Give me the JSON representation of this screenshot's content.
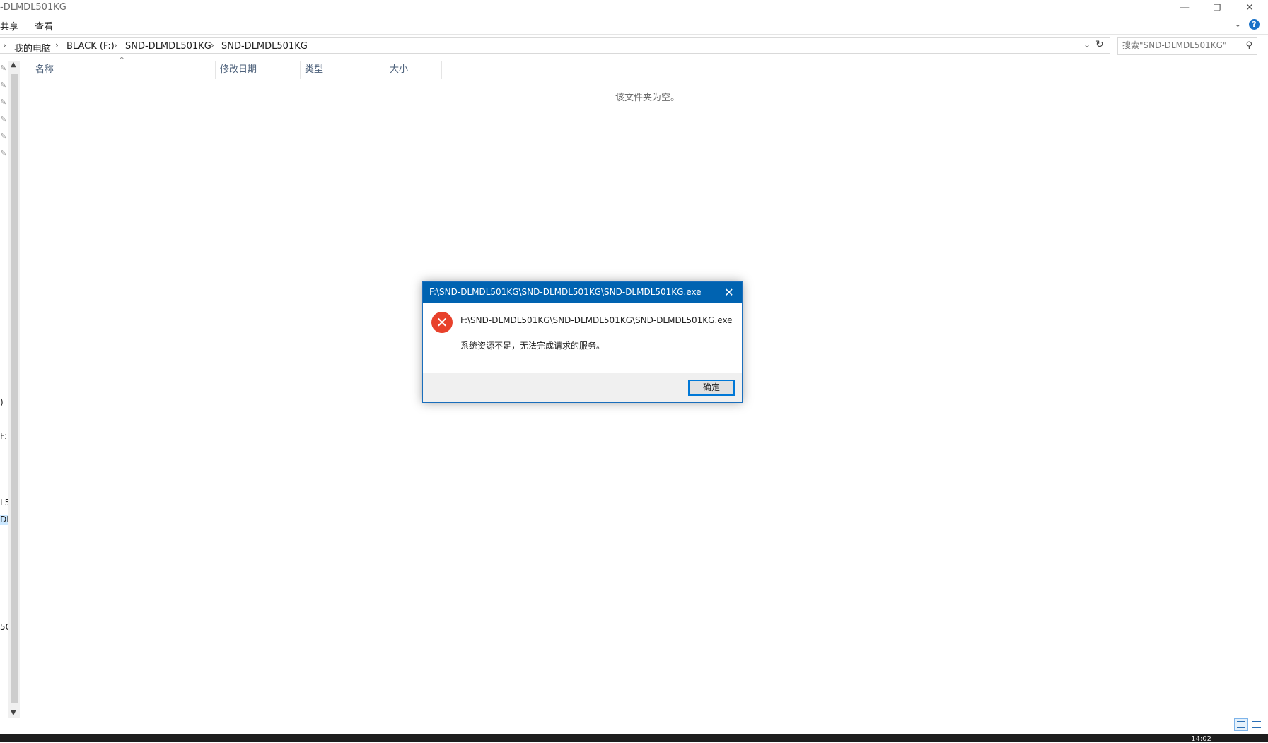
{
  "window": {
    "title": "-DLMDL501KG",
    "controls": {
      "minimize": "—",
      "restore": "❐",
      "close": "✕"
    }
  },
  "ribbon": {
    "tabs": [
      "共享",
      "查看"
    ],
    "visible_tabs_text": {
      "share": "共享",
      "view": "查看"
    },
    "help": "?"
  },
  "address": {
    "breadcrumbs": [
      "我的电脑",
      "BLACK (F:)",
      "SND-DLMDL501KG",
      "SND-DLMDL501KG"
    ],
    "crumb_0": "我的电脑",
    "crumb_1": "BLACK (F:)",
    "crumb_2": "SND-DLMDL501KG",
    "crumb_3": "SND-DLMDL501KG"
  },
  "search": {
    "placeholder": "搜索\"SND-DLMDL501KG\""
  },
  "nav_fragments": {
    "f1": ")",
    "f2": "F:)",
    "f3": "L5",
    "f4": "DI",
    "f5": "50"
  },
  "columns": {
    "name": "名称",
    "modified": "修改日期",
    "type": "类型",
    "size": "大小"
  },
  "content": {
    "empty_message": "该文件夹为空。"
  },
  "dialog": {
    "title": "F:\\SND-DLMDL501KG\\SND-DLMDL501KG\\SND-DLMDL501KG.exe",
    "path": "F:\\SND-DLMDL501KG\\SND-DLMDL501KG\\SND-DLMDL501KG.exe",
    "message": "系统资源不足，无法完成请求的服务。",
    "ok_label": "确定",
    "icon": "error-icon"
  },
  "taskbar": {
    "clock": "14:02"
  }
}
